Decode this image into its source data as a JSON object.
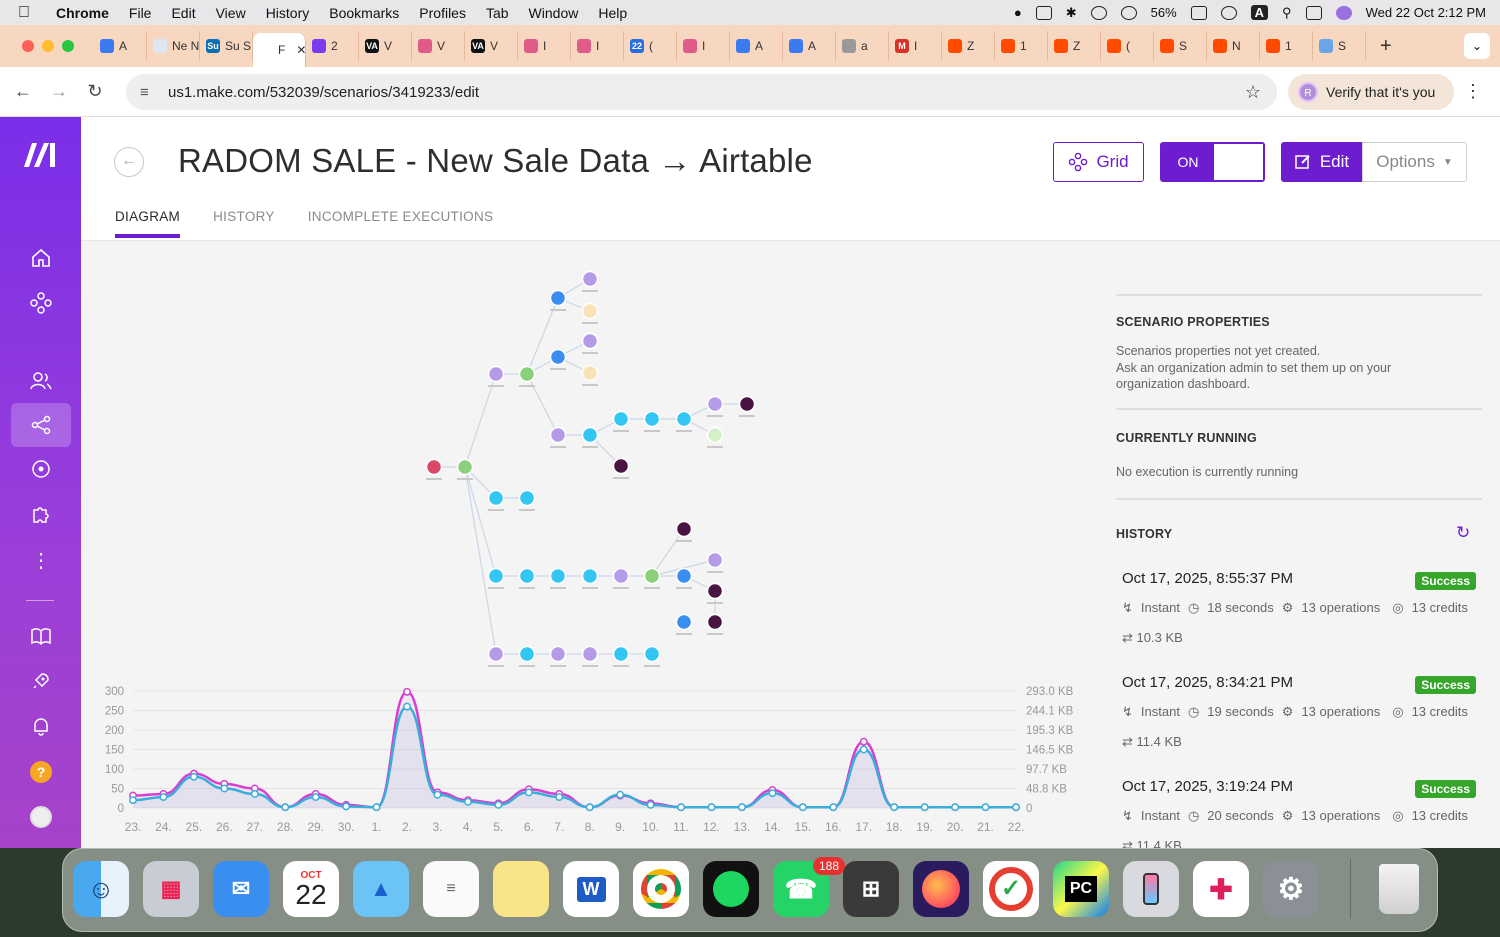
{
  "menubar": {
    "app": "Chrome",
    "items": [
      "File",
      "Edit",
      "View",
      "History",
      "Bookmarks",
      "Profiles",
      "Tab",
      "Window",
      "Help"
    ],
    "battery": "56%",
    "input_source": "A",
    "datetime": "Wed 22 Oct  2:12 PM"
  },
  "tabs": [
    {
      "label": "A",
      "color": "#3b7bef",
      "glyph": ""
    },
    {
      "label": "Ne N",
      "color": "#dfe6f2",
      "glyph": ""
    },
    {
      "label": "Su S",
      "color": "#0b6fb3",
      "glyph": "Su"
    },
    {
      "label": "F",
      "color": "#ffffff",
      "glyph": ""
    },
    {
      "label": "2",
      "color": "#7c3aed",
      "glyph": ""
    },
    {
      "label": "V",
      "color": "#111111",
      "glyph": "VA"
    },
    {
      "label": "V",
      "color": "#e05a8a",
      "glyph": ""
    },
    {
      "label": "V",
      "color": "#111111",
      "glyph": "VA"
    },
    {
      "label": "I",
      "color": "#e05a8a",
      "glyph": ""
    },
    {
      "label": "I",
      "color": "#e05a8a",
      "glyph": ""
    },
    {
      "label": "(",
      "color": "#2a6fe0",
      "glyph": "22"
    },
    {
      "label": "I",
      "color": "#e05a8a",
      "glyph": ""
    },
    {
      "label": "A",
      "color": "#3b7bef",
      "glyph": ""
    },
    {
      "label": "A",
      "color": "#3b7bef",
      "glyph": ""
    },
    {
      "label": "a",
      "color": "#999999",
      "glyph": ""
    },
    {
      "label": "I",
      "color": "#d93025",
      "glyph": "M"
    },
    {
      "label": "Z",
      "color": "#ff4a00",
      "glyph": ""
    },
    {
      "label": "1",
      "color": "#ff4a00",
      "glyph": ""
    },
    {
      "label": "Z",
      "color": "#ff4a00",
      "glyph": ""
    },
    {
      "label": "(",
      "color": "#ff4a00",
      "glyph": ""
    },
    {
      "label": "S",
      "color": "#ff4a00",
      "glyph": ""
    },
    {
      "label": "N",
      "color": "#ff4a00",
      "glyph": ""
    },
    {
      "label": "1",
      "color": "#ff4a00",
      "glyph": ""
    },
    {
      "label": "S",
      "color": "#6aa5e8",
      "glyph": ""
    }
  ],
  "address": {
    "url": "us1.make.com/532039/scenarios/3419233/edit",
    "verify_label": "Verify that it's you",
    "avatar_letter": "R"
  },
  "scenario": {
    "title": "RADOM SALE - New Sale Data → Airtable",
    "tabs": [
      "DIAGRAM",
      "HISTORY",
      "INCOMPLETE EXECUTIONS"
    ],
    "grid_label": "Grid",
    "toggle_label": "ON",
    "edit_label": "Edit",
    "options_label": "Options"
  },
  "panel": {
    "props_title": "SCENARIO PROPERTIES",
    "props_text": [
      "Scenarios properties not yet created.",
      "Ask an organization admin to set them up on your",
      "organization dashboard."
    ],
    "running_title": "CURRENTLY RUNNING",
    "running_text": "No execution is currently running",
    "history_title": "HISTORY",
    "history": [
      {
        "date": "Oct 17, 2025, 8:55:37 PM",
        "status": "Success",
        "trigger": "Instant",
        "duration": "18 seconds",
        "operations": "13 operations",
        "credits": "13 credits",
        "size": "10.3 KB"
      },
      {
        "date": "Oct 17, 2025, 8:34:21 PM",
        "status": "Success",
        "trigger": "Instant",
        "duration": "19 seconds",
        "operations": "13 operations",
        "credits": "13 credits",
        "size": "11.4 KB"
      },
      {
        "date": "Oct 17, 2025, 3:19:24 PM",
        "status": "Success",
        "trigger": "Instant",
        "duration": "20 seconds",
        "operations": "13 operations",
        "credits": "13 credits",
        "size": "11.4 KB"
      }
    ]
  },
  "chart_data": {
    "type": "line",
    "categories": [
      "23.",
      "24.",
      "25.",
      "26.",
      "27.",
      "28.",
      "29.",
      "30.",
      "1.",
      "2.",
      "3.",
      "4.",
      "5.",
      "6.",
      "7.",
      "8.",
      "9.",
      "10.",
      "11.",
      "12.",
      "13.",
      "14.",
      "15.",
      "16.",
      "17.",
      "18.",
      "19.",
      "20.",
      "21.",
      "22."
    ],
    "ylim": [
      0,
      300
    ],
    "y_ticks": [
      "300",
      "250",
      "200",
      "150",
      "100",
      "50",
      "0"
    ],
    "y2_ticks": [
      "293.0 KB",
      "244.1 KB",
      "195.3 KB",
      "146.5 KB",
      "97.7 KB",
      "48.8 KB",
      "0"
    ],
    "series": [
      {
        "color": "#d63fd1",
        "values": [
          32,
          36,
          88,
          62,
          50,
          2,
          36,
          8,
          2,
          298,
          40,
          20,
          12,
          48,
          36,
          2,
          32,
          12,
          2,
          2,
          2,
          46,
          2,
          2,
          170,
          2,
          2,
          2,
          2,
          2
        ]
      },
      {
        "color": "#3aaed8",
        "values": [
          20,
          28,
          80,
          50,
          36,
          2,
          28,
          4,
          2,
          260,
          34,
          16,
          8,
          40,
          28,
          2,
          34,
          8,
          2,
          2,
          2,
          38,
          2,
          2,
          150,
          2,
          2,
          2,
          2,
          2
        ]
      }
    ]
  },
  "dock": {
    "calendar_month": "OCT",
    "calendar_day": "22",
    "whatsapp_badge": "188",
    "word_letter": "W",
    "pycharm_label": "PC"
  }
}
